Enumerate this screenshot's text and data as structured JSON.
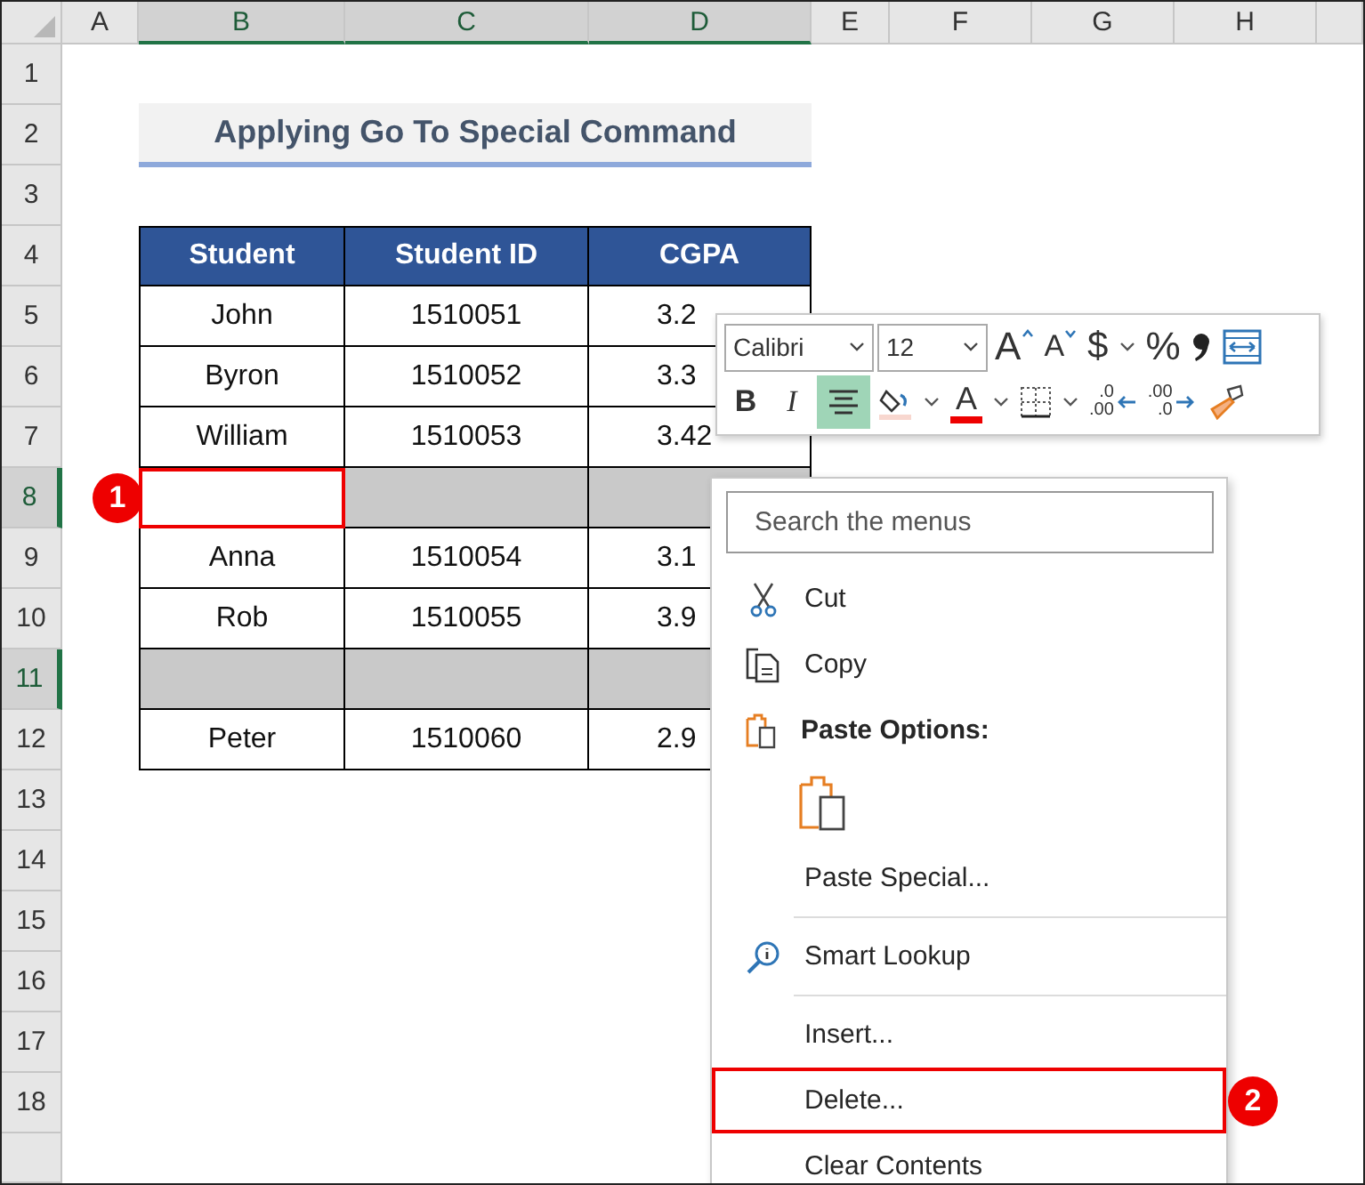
{
  "sheet": {
    "columns": [
      {
        "letter": "A",
        "selected": false
      },
      {
        "letter": "B",
        "selected": true
      },
      {
        "letter": "C",
        "selected": true
      },
      {
        "letter": "D",
        "selected": true
      },
      {
        "letter": "E",
        "selected": false
      },
      {
        "letter": "F",
        "selected": false
      },
      {
        "letter": "G",
        "selected": false
      },
      {
        "letter": "H",
        "selected": false
      }
    ],
    "rows": [
      {
        "number": "1",
        "selected": false
      },
      {
        "number": "2",
        "selected": false
      },
      {
        "number": "3",
        "selected": false
      },
      {
        "number": "4",
        "selected": false
      },
      {
        "number": "5",
        "selected": false
      },
      {
        "number": "6",
        "selected": false
      },
      {
        "number": "7",
        "selected": false
      },
      {
        "number": "8",
        "selected": true
      },
      {
        "number": "9",
        "selected": false
      },
      {
        "number": "10",
        "selected": false
      },
      {
        "number": "11",
        "selected": true
      },
      {
        "number": "12",
        "selected": false
      },
      {
        "number": "13",
        "selected": false
      },
      {
        "number": "14",
        "selected": false
      },
      {
        "number": "15",
        "selected": false
      },
      {
        "number": "16",
        "selected": false
      },
      {
        "number": "17",
        "selected": false
      },
      {
        "number": "18",
        "selected": false
      }
    ],
    "title": "Applying Go To Special Command",
    "table": {
      "columns": [
        "Student",
        "Student ID",
        "CGPA"
      ],
      "rows": [
        {
          "cells": [
            "John",
            "1510051",
            "3.2"
          ],
          "selected": false
        },
        {
          "cells": [
            "Byron",
            "1510052",
            "3.3"
          ],
          "selected": false
        },
        {
          "cells": [
            "William",
            "1510053",
            "3.42"
          ],
          "selected": false
        },
        {
          "selected": true,
          "active": true,
          "callout": "1"
        },
        {
          "cells": [
            "Anna",
            "1510054",
            "3.1"
          ],
          "selected": false
        },
        {
          "cells": [
            "Rob",
            "1510055",
            "3.9"
          ],
          "selected": false
        },
        {
          "selected": true,
          "active": false
        },
        {
          "cells": [
            "Peter",
            "1510060",
            "2.9"
          ],
          "selected": false
        }
      ]
    }
  },
  "mini_toolbar": {
    "font": {
      "value": "Calibri"
    },
    "size": {
      "value": "12"
    },
    "row_1": [
      {
        "kind": "grow",
        "label": "A"
      },
      {
        "kind": "shrink",
        "label": "A"
      },
      {
        "kind": "currency",
        "label": "$"
      },
      {
        "kind": "caret"
      },
      {
        "kind": "percent",
        "label": "%"
      },
      {
        "kind": "comma"
      },
      {
        "kind": "wrap"
      }
    ],
    "row_2": [
      {
        "kind": "bold",
        "label": "B",
        "selected": false
      },
      {
        "kind": "italic",
        "label": "I",
        "selected": false
      },
      {
        "kind": "center",
        "selected": true
      },
      {
        "kind": "fill"
      },
      {
        "kind": "caret"
      },
      {
        "kind": "font-color",
        "label": "A"
      },
      {
        "kind": "caret"
      },
      {
        "kind": "borders"
      },
      {
        "kind": "caret"
      },
      {
        "kind": "increase-decimal",
        "label": ".0",
        "label_2": ".00"
      },
      {
        "kind": "decrease-decimal",
        "label": ".00",
        "label_2": ".0"
      },
      {
        "kind": "painter"
      }
    ]
  },
  "context_menu": {
    "search": {
      "placeholder": "Search the menus"
    },
    "items": [
      {
        "kind": "cut",
        "label": "Cut",
        "highlighted": false
      },
      {
        "kind": "copy",
        "label": "Copy",
        "highlighted": false
      },
      {
        "kind": "paste-heading",
        "label": "Paste Options:"
      },
      {
        "kind": "paste-option"
      },
      {
        "kind": "plain",
        "label": "Paste Special...",
        "highlighted": false
      },
      {
        "kind": "separator"
      },
      {
        "kind": "lookup",
        "label": "Smart Lookup",
        "highlighted": false
      },
      {
        "kind": "separator"
      },
      {
        "kind": "plain",
        "label": "Insert...",
        "highlighted": false
      },
      {
        "kind": "plain",
        "label": "Delete...",
        "highlighted": true,
        "callout": "2"
      },
      {
        "kind": "plain",
        "label": "Clear Contents",
        "highlighted": false
      }
    ]
  }
}
